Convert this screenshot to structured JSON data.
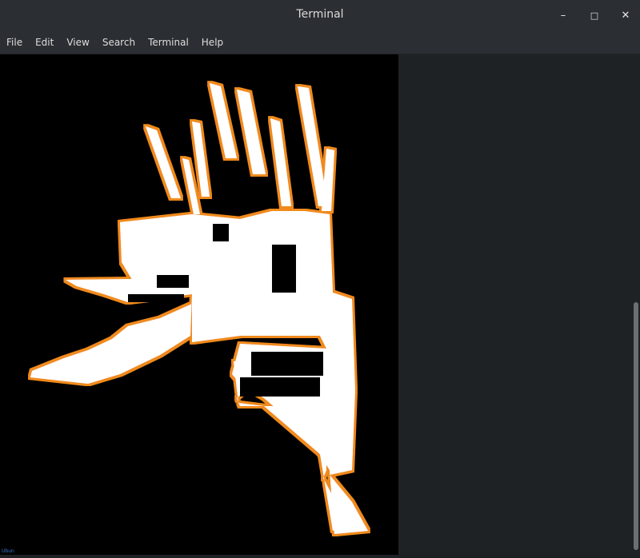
{
  "window": {
    "title": "Terminal",
    "controls": {
      "minimize": "–",
      "maximize": "□",
      "close": "✕"
    }
  },
  "menu": [
    "File",
    "Edit",
    "View",
    "Search",
    "Terminal",
    "Help"
  ],
  "colors": {
    "titlebar": "#2b2e32",
    "terminal_bg": "#1f2225",
    "image_bg": "#000000",
    "glyph_fill": "#ffffff",
    "glyph_glow": "#f08a1c",
    "scrollbar": "#6b6f73"
  },
  "terminal": {
    "rendered_image": "pixelated white glyph with orange outline",
    "corner_text": "Ubun"
  }
}
